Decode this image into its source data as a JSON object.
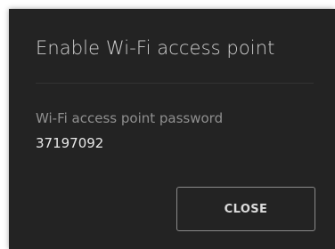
{
  "dialog": {
    "title": "Enable Wi-Fi access point",
    "password_label": "Wi-Fi access point password",
    "password_value": "37197092",
    "close_label": "CLOSE"
  },
  "colors": {
    "dialog_background": "#232323",
    "title_text": "#cfcfcf",
    "label_text": "#8f8f8f",
    "value_text": "#e8e8e8",
    "button_border": "#8a8a8a"
  }
}
